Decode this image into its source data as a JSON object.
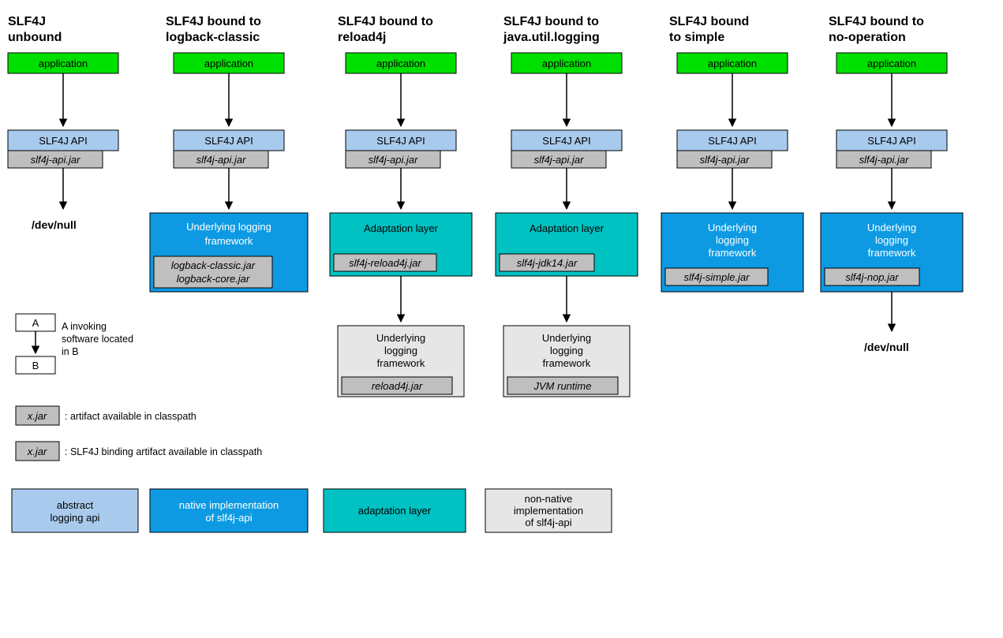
{
  "colors": {
    "green": "#00e000",
    "lightblue": "#a8caed",
    "gray": "#bfbfbf",
    "darkblue": "#0d9ae3",
    "teal": "#00c2c2",
    "lightgray": "#e6e6e6",
    "bindingBorder": "#8a2a2a"
  },
  "columns": [
    {
      "title1": "SLF4J",
      "title2": "unbound",
      "app": "application",
      "api": "SLF4J API",
      "apiJar": "slf4j-api.jar",
      "devnull": "/dev/null"
    },
    {
      "title1": "SLF4J bound to",
      "title2": "logback-classic",
      "app": "application",
      "api": "SLF4J API",
      "apiJar": "slf4j-api.jar",
      "underlying1": "Underlying logging",
      "underlying2": "framework",
      "underlyingJar1": "logback-classic.jar",
      "underlyingJar2": "logback-core.jar"
    },
    {
      "title1": "SLF4J bound to",
      "title2": "reload4j",
      "app": "application",
      "api": "SLF4J API",
      "apiJar": "slf4j-api.jar",
      "adapt": "Adaptation layer",
      "adaptJar": "slf4j-reload4j.jar",
      "ul1": "Underlying",
      "ul2": "logging",
      "ul3": "framework",
      "ulJar": "reload4j.jar"
    },
    {
      "title1": "SLF4J bound to",
      "title2": "java.util.logging",
      "app": "application",
      "api": "SLF4J API",
      "apiJar": "slf4j-api.jar",
      "adapt": "Adaptation layer",
      "adaptJar": "slf4j-jdk14.jar",
      "ul1": "Underlying",
      "ul2": "logging",
      "ul3": "framework",
      "ulJar": "JVM runtime"
    },
    {
      "title1": "SLF4J bound",
      "title2": "to simple",
      "app": "application",
      "api": "SLF4J API",
      "apiJar": "slf4j-api.jar",
      "ul1": "Underlying",
      "ul2": "logging",
      "ul3": "framework",
      "ulJar": "slf4j-simple.jar"
    },
    {
      "title1": "SLF4J bound to",
      "title2": "no-operation",
      "app": "application",
      "api": "SLF4J API",
      "apiJar": "slf4j-api.jar",
      "ul1": "Underlying",
      "ul2": "logging",
      "ul3": "framework",
      "ulJar": "slf4j-nop.jar",
      "devnull": "/dev/null"
    }
  ],
  "legend": {
    "A": "A",
    "B": "B",
    "invoke1": "A invoking",
    "invoke2": "software located",
    "invoke3": "in B",
    "xjar": "x.jar",
    "artifact": ": artifact available in classpath",
    "binding": ": SLF4J binding artifact available in classpath",
    "abstract1": "abstract",
    "abstract2": "logging api",
    "native1": "native implementation",
    "native2": "of slf4j-api",
    "adaptLayer": "adaptation layer",
    "nonnative1": "non-native",
    "nonnative2": "implementation",
    "nonnative3": "of slf4j-api"
  }
}
